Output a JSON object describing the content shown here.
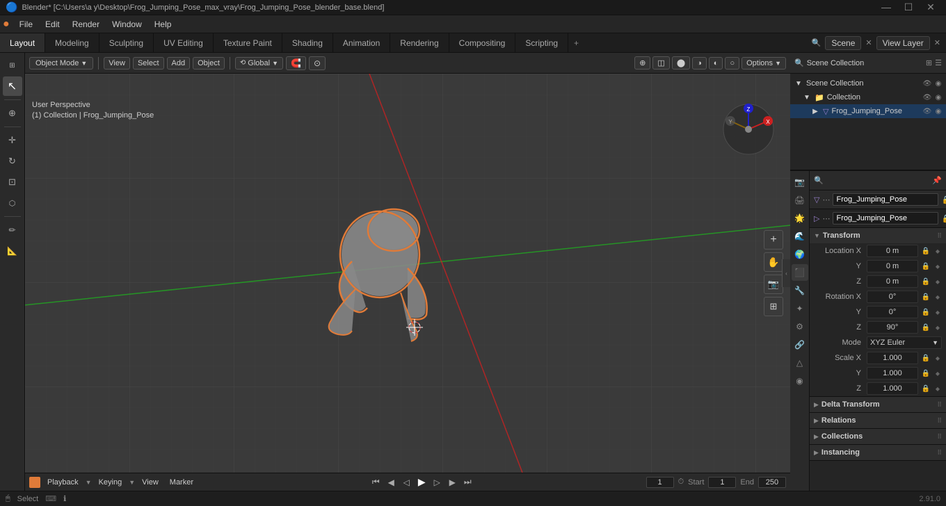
{
  "titlebar": {
    "title": "Blender* [C:\\Users\\a y\\Desktop\\Frog_Jumping_Pose_max_vray\\Frog_Jumping_Pose_blender_base.blend]",
    "controls": [
      "—",
      "☐",
      "✕"
    ]
  },
  "menubar": {
    "items": [
      "Blender",
      "File",
      "Edit",
      "Render",
      "Window",
      "Help"
    ]
  },
  "workspace_tabs": {
    "tabs": [
      "Layout",
      "Modeling",
      "Sculpting",
      "UV Editing",
      "Texture Paint",
      "Shading",
      "Animation",
      "Rendering",
      "Compositing",
      "Scripting"
    ],
    "active": "Layout",
    "plus_label": "+",
    "scene_label": "Scene",
    "viewlayer_label": "View Layer"
  },
  "viewport_header": {
    "mode_label": "Object Mode",
    "view_label": "View",
    "select_label": "Select",
    "add_label": "Add",
    "object_label": "Object",
    "transform_label": "Global",
    "options_label": "Options"
  },
  "viewport_info": {
    "perspective": "User Perspective",
    "collection": "(1) Collection | Frog_Jumping_Pose"
  },
  "left_tools": {
    "tools": [
      "↖",
      "⊕",
      "↔",
      "↻",
      "⊞",
      "✏",
      "📐"
    ]
  },
  "outliner": {
    "header_label": "Scene Collection",
    "items": [
      {
        "label": "Scene Collection",
        "level": 0,
        "icon": "📁",
        "active": false,
        "eye": true,
        "cam": true
      },
      {
        "label": "Collection",
        "level": 1,
        "icon": "📁",
        "active": false,
        "eye": true,
        "cam": true
      },
      {
        "label": "Frog_Jumping_Pose",
        "level": 2,
        "icon": "▽",
        "active": true,
        "eye": true,
        "cam": true
      }
    ]
  },
  "properties": {
    "object_name": "Frog_Jumping_Pose",
    "data_name": "Frog_Jumping_Pose",
    "transform": {
      "label": "Transform",
      "location_x": "0 m",
      "location_y": "0 m",
      "location_z": "0 m",
      "rotation_x": "0°",
      "rotation_y": "0°",
      "rotation_z": "90°",
      "mode_label": "Mode",
      "mode_value": "XYZ Euler",
      "scale_x": "1.000",
      "scale_y": "1.000",
      "scale_z": "1.000"
    },
    "delta_transform_label": "Delta Transform",
    "relations_label": "Relations",
    "collections_label": "Collections",
    "instancing_label": "Instancing"
  },
  "prop_icons": [
    "🖱",
    "📷",
    "🌟",
    "🌊",
    "🔩",
    "⚙",
    "🔧",
    "🔗",
    "📊",
    "💡",
    "🎨"
  ],
  "bottom_timeline": {
    "playback_label": "Playback",
    "keying_label": "Keying",
    "view_label": "View",
    "marker_label": "Marker",
    "frame_current": "1",
    "start_label": "Start",
    "start_value": "1",
    "end_label": "End",
    "end_value": "250",
    "controls": [
      "⏮",
      "◀",
      "▶",
      "⏵",
      "▶▶",
      "⏭"
    ]
  },
  "status_bar": {
    "select_label": "Select",
    "version": "2.91.0"
  },
  "colors": {
    "active_tab_bg": "#2d2d2d",
    "outliner_active": "#1d3a5c",
    "accent": "#e07b39",
    "grid_line": "#444",
    "axis_x": "#cc2020",
    "axis_y": "#20aa20",
    "axis_z": "#2020cc",
    "frog_outline": "#e07b39"
  }
}
